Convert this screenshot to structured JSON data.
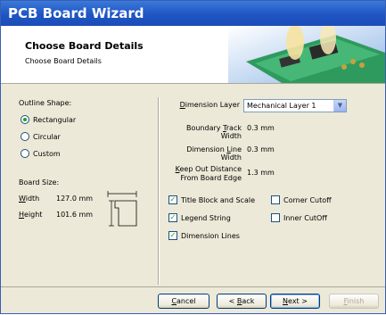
{
  "window": {
    "title": "PCB Board Wizard"
  },
  "header": {
    "title": "Choose Board Details",
    "subtitle": "Choose Board Details"
  },
  "left": {
    "outline_label": "Outline Shape:",
    "shapes": [
      {
        "label": "Rectangular",
        "selected": true
      },
      {
        "label": "Circular",
        "selected": false
      },
      {
        "label": "Custom",
        "selected": false
      }
    ],
    "board_size_label": "Board Size:",
    "width_label": "Width",
    "width_value": "127.0 mm",
    "height_label": "Height",
    "height_value": "101.6 mm"
  },
  "right": {
    "dimension_layer_label": "Dimension Layer",
    "dimension_layer_value": "Mechanical Layer 1",
    "boundary_label": "Boundary Track Width",
    "boundary_value": "0.3 mm",
    "dimline_label": "Dimension Line Width",
    "dimline_value": "0.3 mm",
    "keepout_label_1": "Keep Out Distance",
    "keepout_label_2": "From Board Edge",
    "keepout_value": "1.3 mm",
    "checks": {
      "title_block": {
        "label": "Title Block and Scale",
        "checked": true
      },
      "legend": {
        "label": "Legend String",
        "checked": true
      },
      "dim_lines": {
        "label": "Dimension Lines",
        "checked": true
      },
      "corner": {
        "label": "Corner Cutoff",
        "checked": false
      },
      "inner": {
        "label": "Inner CutOff",
        "checked": false
      }
    }
  },
  "buttons": {
    "cancel": "Cancel",
    "back": "< Back",
    "next": "Next >",
    "finish": "Finish"
  },
  "colors": {
    "titlebar": "#1f55c4",
    "accent_check": "#21a121"
  }
}
